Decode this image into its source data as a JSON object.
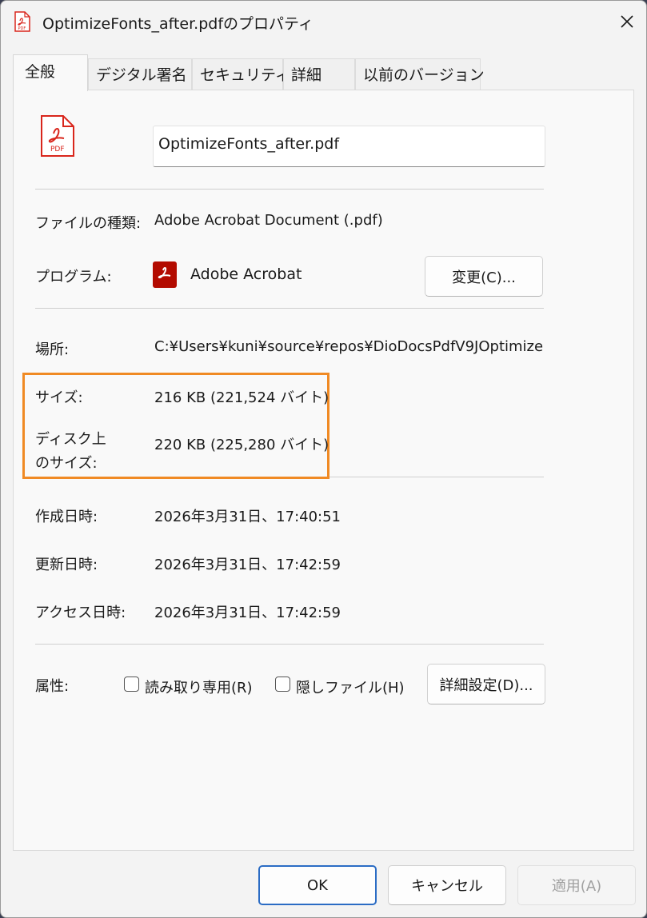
{
  "window": {
    "title": "OptimizeFonts_after.pdfのプロパティ",
    "title_icon": "pdf-file-icon",
    "close_icon": "close-icon"
  },
  "tabs": [
    {
      "label": "全般",
      "active": true
    },
    {
      "label": "デジタル署名"
    },
    {
      "label": "セキュリティ"
    },
    {
      "label": "詳細"
    },
    {
      "label": "以前のバージョン"
    }
  ],
  "general": {
    "file_icon_label": "PDF",
    "filename": "OptimizeFonts_after.pdf",
    "file_type_label": "ファイルの種類:",
    "file_type_value": "Adobe Acrobat Document (.pdf)",
    "program_label": "プログラム:",
    "program_value": "Adobe Acrobat",
    "change_button": "変更(C)...",
    "location_label": "場所:",
    "location_value": "C:¥Users¥kuni¥source¥repos¥DioDocsPdfV9JOptimize",
    "size_label": "サイズ:",
    "size_value": "216 KB (221,524 バイト)",
    "disk_size_label_line1": "ディスク上",
    "disk_size_label_line2": "のサイズ:",
    "disk_size_value": "220 KB (225,280 バイト)",
    "created_label": "作成日時:",
    "created_value": "2026年3月31日、17:40:51",
    "modified_label": "更新日時:",
    "modified_value": "2026年3月31日、17:42:59",
    "accessed_label": "アクセス日時:",
    "accessed_value": "2026年3月31日、17:42:59",
    "attributes_label": "属性:",
    "readonly_label": "読み取り専用(R)",
    "hidden_label": "隠しファイル(H)",
    "advanced_button": "詳細設定(D)..."
  },
  "footer": {
    "ok": "OK",
    "cancel": "キャンセル",
    "apply": "適用(A)"
  },
  "colors": {
    "highlight": "#f08a24",
    "acrobat_red": "#b30b00",
    "pdf_red": "#d9261c"
  }
}
